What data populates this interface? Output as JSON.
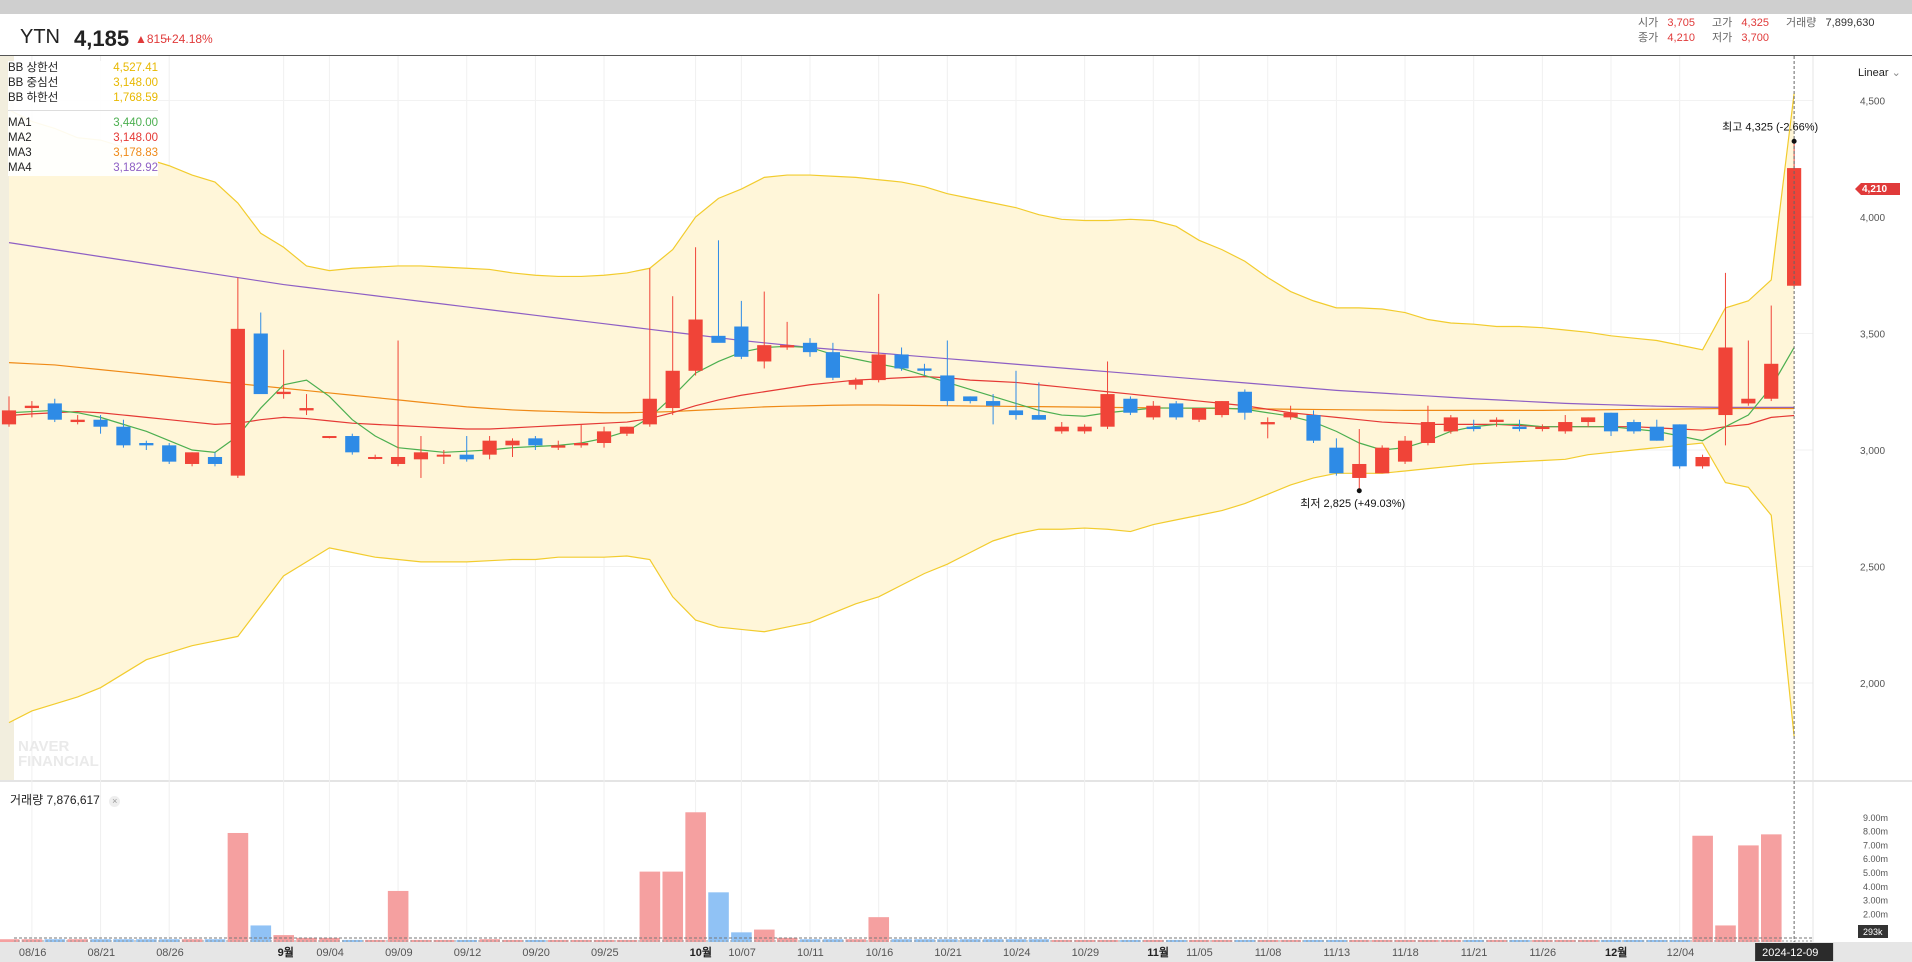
{
  "header": {
    "symbol": "YTN",
    "price": "4,185",
    "change": "▲815",
    "change_pct": "+24.18%",
    "open_label": "시가",
    "open": "3,705",
    "high_label": "고가",
    "high": "4,325",
    "volume_label": "거래량",
    "volume": "7,899,630",
    "close_label": "종가",
    "close": "4,210",
    "low_label": "저가",
    "low": "3,700"
  },
  "legend": [
    {
      "name": "BB 상한선",
      "value": "4,527.41",
      "color": "#e8b800"
    },
    {
      "name": "BB 중심선",
      "value": "3,148.00",
      "color": "#e8b800"
    },
    {
      "name": "BB 하한선",
      "value": "1,768.59",
      "color": "#e8b800"
    },
    {
      "name": "MA1",
      "value": "3,440.00",
      "color": "#4caf50"
    },
    {
      "name": "MA2",
      "value": "3,148.00",
      "color": "#e53935"
    },
    {
      "name": "MA3",
      "value": "3,178.83",
      "color": "#ef8a17"
    },
    {
      "name": "MA4",
      "value": "3,182.92",
      "color": "#8e5fc4"
    }
  ],
  "volume_legend": {
    "label": "거래량",
    "value": "7,876,617",
    "close": "×"
  },
  "scale_mode": "Linear",
  "watermark": "NAVER FINANCIAL",
  "colors": {
    "up": "#f04438",
    "down": "#2e8be6",
    "up_vol": "#f5a0a0",
    "down_vol": "#90c2f5",
    "band_fill": "#fff6d9",
    "band_line": "#f2cc2e",
    "price_tag": "#e03a3a"
  },
  "annotations": {
    "high": "최고 4,325 (-2.66%)",
    "low": "최저 2,825 (+49.03%)"
  },
  "price_tag": "4,210",
  "volume_tag": "293k",
  "crosshair_date": "2024-12-09",
  "chart_data": {
    "type": "candlestick",
    "y_axis": {
      "ticks": [
        2000,
        2500,
        3000,
        3500,
        4000,
        4500
      ],
      "tick_labels": [
        "2,000",
        "2,500",
        "3,000",
        "3,500",
        "4,000",
        "4,500"
      ],
      "range": [
        1700,
        4600
      ]
    },
    "volume_axis": {
      "ticks": [
        2000000,
        3000000,
        4000000,
        5000000,
        6000000,
        7000000,
        8000000,
        9000000
      ],
      "tick_labels": [
        "2.00m",
        "3.00m",
        "4.00m",
        "5.00m",
        "6.00m",
        "7.00m",
        "8.00m",
        "9.00m"
      ],
      "range": [
        0,
        10000000
      ]
    },
    "x_labels": [
      "08/16",
      "08/21",
      "08/26",
      "9월",
      "09/04",
      "09/09",
      "09/12",
      "09/20",
      "09/25",
      "10월",
      "10/07",
      "10/11",
      "10/16",
      "10/21",
      "10/24",
      "10/29",
      "11월",
      "11/05",
      "11/08",
      "11/13",
      "11/18",
      "11/21",
      "11/26",
      "12월",
      "12/04"
    ],
    "x_label_idx": [
      1,
      4,
      7,
      12,
      14,
      17,
      20,
      23,
      26,
      30,
      32,
      35,
      38,
      41,
      44,
      47,
      50,
      52,
      55,
      58,
      61,
      64,
      67,
      70,
      73
    ],
    "candles": [
      {
        "o": 3110,
        "h": 3230,
        "l": 3100,
        "c": 3170
      },
      {
        "o": 3180,
        "h": 3210,
        "l": 3140,
        "c": 3190
      },
      {
        "o": 3200,
        "h": 3220,
        "l": 3120,
        "c": 3130
      },
      {
        "o": 3120,
        "h": 3150,
        "l": 3110,
        "c": 3130
      },
      {
        "o": 3130,
        "h": 3150,
        "l": 3070,
        "c": 3100
      },
      {
        "o": 3100,
        "h": 3130,
        "l": 3010,
        "c": 3020
      },
      {
        "o": 3030,
        "h": 3040,
        "l": 3000,
        "c": 3020
      },
      {
        "o": 3020,
        "h": 3030,
        "l": 2940,
        "c": 2950
      },
      {
        "o": 2940,
        "h": 2990,
        "l": 2930,
        "c": 2990
      },
      {
        "o": 2970,
        "h": 2990,
        "l": 2930,
        "c": 2940
      },
      {
        "o": 2890,
        "h": 3740,
        "l": 2880,
        "c": 3520
      },
      {
        "o": 3500,
        "h": 3590,
        "l": 3250,
        "c": 3240
      },
      {
        "o": 3240,
        "h": 3430,
        "l": 3220,
        "c": 3250
      },
      {
        "o": 3170,
        "h": 3240,
        "l": 3150,
        "c": 3180
      },
      {
        "o": 3060,
        "h": 3060,
        "l": 3050,
        "c": 3060
      },
      {
        "o": 3060,
        "h": 3070,
        "l": 2980,
        "c": 2990
      },
      {
        "o": 2970,
        "h": 2980,
        "l": 2960,
        "c": 2970
      },
      {
        "o": 2940,
        "h": 3470,
        "l": 2930,
        "c": 2970
      },
      {
        "o": 2960,
        "h": 3060,
        "l": 2880,
        "c": 2990
      },
      {
        "o": 2980,
        "h": 3000,
        "l": 2940,
        "c": 2980
      },
      {
        "o": 2980,
        "h": 3060,
        "l": 2950,
        "c": 2960
      },
      {
        "o": 2980,
        "h": 3060,
        "l": 2960,
        "c": 3040
      },
      {
        "o": 3020,
        "h": 3050,
        "l": 2970,
        "c": 3040
      },
      {
        "o": 3050,
        "h": 3060,
        "l": 3000,
        "c": 3020
      },
      {
        "o": 3010,
        "h": 3040,
        "l": 3000,
        "c": 3020
      },
      {
        "o": 3020,
        "h": 3110,
        "l": 3010,
        "c": 3030
      },
      {
        "o": 3030,
        "h": 3100,
        "l": 3010,
        "c": 3080
      },
      {
        "o": 3070,
        "h": 3100,
        "l": 3060,
        "c": 3100
      },
      {
        "o": 3110,
        "h": 3780,
        "l": 3100,
        "c": 3220
      },
      {
        "o": 3180,
        "h": 3660,
        "l": 3150,
        "c": 3340
      },
      {
        "o": 3340,
        "h": 3870,
        "l": 3320,
        "c": 3560
      },
      {
        "o": 3490,
        "h": 3900,
        "l": 3470,
        "c": 3460
      },
      {
        "o": 3530,
        "h": 3640,
        "l": 3390,
        "c": 3400
      },
      {
        "o": 3380,
        "h": 3680,
        "l": 3350,
        "c": 3450
      },
      {
        "o": 3440,
        "h": 3550,
        "l": 3430,
        "c": 3450
      },
      {
        "o": 3460,
        "h": 3480,
        "l": 3400,
        "c": 3420
      },
      {
        "o": 3420,
        "h": 3460,
        "l": 3300,
        "c": 3310
      },
      {
        "o": 3280,
        "h": 3310,
        "l": 3260,
        "c": 3300
      },
      {
        "o": 3300,
        "h": 3670,
        "l": 3290,
        "c": 3410
      },
      {
        "o": 3410,
        "h": 3440,
        "l": 3340,
        "c": 3350
      },
      {
        "o": 3350,
        "h": 3370,
        "l": 3320,
        "c": 3340
      },
      {
        "o": 3320,
        "h": 3470,
        "l": 3190,
        "c": 3210
      },
      {
        "o": 3230,
        "h": 3230,
        "l": 3200,
        "c": 3210
      },
      {
        "o": 3210,
        "h": 3240,
        "l": 3110,
        "c": 3190
      },
      {
        "o": 3170,
        "h": 3340,
        "l": 3130,
        "c": 3150
      },
      {
        "o": 3150,
        "h": 3290,
        "l": 3130,
        "c": 3130
      },
      {
        "o": 3080,
        "h": 3120,
        "l": 3070,
        "c": 3100
      },
      {
        "o": 3080,
        "h": 3110,
        "l": 3070,
        "c": 3100
      },
      {
        "o": 3100,
        "h": 3380,
        "l": 3090,
        "c": 3240
      },
      {
        "o": 3220,
        "h": 3230,
        "l": 3150,
        "c": 3160
      },
      {
        "o": 3140,
        "h": 3210,
        "l": 3130,
        "c": 3190
      },
      {
        "o": 3200,
        "h": 3210,
        "l": 3130,
        "c": 3140
      },
      {
        "o": 3130,
        "h": 3180,
        "l": 3120,
        "c": 3180
      },
      {
        "o": 3150,
        "h": 3210,
        "l": 3140,
        "c": 3210
      },
      {
        "o": 3250,
        "h": 3260,
        "l": 3130,
        "c": 3160
      },
      {
        "o": 3110,
        "h": 3140,
        "l": 3050,
        "c": 3120
      },
      {
        "o": 3140,
        "h": 3190,
        "l": 3130,
        "c": 3160
      },
      {
        "o": 3150,
        "h": 3170,
        "l": 3030,
        "c": 3040
      },
      {
        "o": 3010,
        "h": 3050,
        "l": 2890,
        "c": 2900
      },
      {
        "o": 2880,
        "h": 3090,
        "l": 2825,
        "c": 2940
      },
      {
        "o": 2900,
        "h": 3020,
        "l": 2900,
        "c": 3010
      },
      {
        "o": 2950,
        "h": 3060,
        "l": 2940,
        "c": 3040
      },
      {
        "o": 3030,
        "h": 3190,
        "l": 3020,
        "c": 3120
      },
      {
        "o": 3080,
        "h": 3150,
        "l": 3070,
        "c": 3140
      },
      {
        "o": 3100,
        "h": 3130,
        "l": 3080,
        "c": 3090
      },
      {
        "o": 3120,
        "h": 3140,
        "l": 3100,
        "c": 3130
      },
      {
        "o": 3100,
        "h": 3130,
        "l": 3080,
        "c": 3090
      },
      {
        "o": 3090,
        "h": 3110,
        "l": 3080,
        "c": 3100
      },
      {
        "o": 3080,
        "h": 3150,
        "l": 3070,
        "c": 3120
      },
      {
        "o": 3120,
        "h": 3140,
        "l": 3100,
        "c": 3140
      },
      {
        "o": 3160,
        "h": 3160,
        "l": 3060,
        "c": 3080
      },
      {
        "o": 3120,
        "h": 3130,
        "l": 3070,
        "c": 3080
      },
      {
        "o": 3100,
        "h": 3130,
        "l": 3040,
        "c": 3040
      },
      {
        "o": 3110,
        "h": 3110,
        "l": 2920,
        "c": 2930
      },
      {
        "o": 2930,
        "h": 2980,
        "l": 2920,
        "c": 2970
      },
      {
        "o": 3150,
        "h": 3760,
        "l": 3020,
        "c": 3440
      },
      {
        "o": 3200,
        "h": 3470,
        "l": 3190,
        "c": 3220
      },
      {
        "o": 3220,
        "h": 3620,
        "l": 3210,
        "c": 3370
      },
      {
        "o": 3705,
        "h": 4325,
        "l": 3700,
        "c": 4210
      }
    ],
    "volume": [
      200000,
      200000,
      200000,
      200000,
      200000,
      200000,
      200000,
      200000,
      200000,
      200000,
      7900000,
      1200000,
      500000,
      300000,
      300000,
      150000,
      150000,
      3700000,
      150000,
      150000,
      150000,
      200000,
      150000,
      150000,
      150000,
      150000,
      150000,
      150000,
      5100000,
      5100000,
      9400000,
      3600000,
      700000,
      900000,
      300000,
      200000,
      200000,
      200000,
      1800000,
      200000,
      200000,
      200000,
      200000,
      200000,
      200000,
      200000,
      150000,
      150000,
      150000,
      150000,
      150000,
      150000,
      150000,
      150000,
      150000,
      150000,
      150000,
      150000,
      150000,
      150000,
      150000,
      150000,
      150000,
      150000,
      150000,
      150000,
      150000,
      150000,
      150000,
      150000,
      150000,
      150000,
      150000,
      150000,
      7700000,
      1200000,
      7000000,
      7800000
    ],
    "bb_upper": [
      4460,
      4410,
      4380,
      4340,
      4330,
      4300,
      4250,
      4220,
      4180,
      4150,
      4060,
      3930,
      3870,
      3790,
      3770,
      3780,
      3785,
      3790,
      3790,
      3785,
      3780,
      3775,
      3760,
      3750,
      3745,
      3745,
      3750,
      3760,
      3780,
      3860,
      4000,
      4080,
      4120,
      4170,
      4180,
      4180,
      4175,
      4170,
      4160,
      4150,
      4130,
      4100,
      4080,
      4060,
      4040,
      4010,
      3990,
      3985,
      3985,
      3990,
      3985,
      3960,
      3900,
      3860,
      3810,
      3740,
      3680,
      3640,
      3610,
      3610,
      3605,
      3590,
      3560,
      3545,
      3540,
      3530,
      3530,
      3525,
      3515,
      3505,
      3490,
      3480,
      3470,
      3450,
      3430,
      3610,
      3640,
      3730,
      4530
    ],
    "bb_mid": [
      3148,
      3150,
      3152,
      3154,
      3155,
      3150,
      3145,
      3140,
      3132,
      3125,
      3120,
      3115,
      3110,
      3108,
      3110,
      3112,
      3110,
      3108,
      3105,
      3100,
      3098,
      3095,
      3092,
      3090,
      3090,
      3090,
      3092,
      3095,
      3100,
      3120,
      3140,
      3160,
      3180,
      3200,
      3215,
      3230,
      3240,
      3245,
      3250,
      3252,
      3250,
      3248,
      3245,
      3240,
      3235,
      3230,
      3225,
      3220,
      3210,
      3200,
      3195,
      3190,
      3185,
      3180,
      3175,
      3170,
      3165,
      3160,
      3155,
      3150,
      3145,
      3145,
      3145,
      3145,
      3145,
      3145,
      3145,
      3145,
      3148,
      3148,
      3148,
      3148,
      3148,
      3148,
      3148,
      3148,
      3148,
      3148,
      3148
    ],
    "bb_lower": [
      1830,
      1880,
      1910,
      1940,
      1980,
      2040,
      2100,
      2130,
      2160,
      2180,
      2200,
      2330,
      2460,
      2520,
      2580,
      2560,
      2540,
      2530,
      2520,
      2520,
      2520,
      2525,
      2530,
      2530,
      2540,
      2540,
      2540,
      2545,
      2530,
      2370,
      2270,
      2240,
      2230,
      2220,
      2240,
      2260,
      2300,
      2340,
      2370,
      2420,
      2470,
      2510,
      2560,
      2610,
      2640,
      2660,
      2660,
      2665,
      2660,
      2650,
      2680,
      2700,
      2720,
      2740,
      2770,
      2810,
      2850,
      2880,
      2900,
      2900,
      2900,
      2910,
      2920,
      2930,
      2940,
      2945,
      2950,
      2955,
      2960,
      2980,
      2990,
      3000,
      3010,
      3020,
      3030,
      2860,
      2840,
      2720,
      1770
    ],
    "ma1": [
      3160,
      3165,
      3170,
      3160,
      3140,
      3110,
      3080,
      3040,
      3000,
      2990,
      3060,
      3180,
      3280,
      3300,
      3230,
      3130,
      3060,
      3010,
      3000,
      2990,
      2995,
      3000,
      3010,
      3015,
      3020,
      3030,
      3050,
      3080,
      3140,
      3230,
      3330,
      3380,
      3420,
      3440,
      3445,
      3440,
      3410,
      3390,
      3370,
      3350,
      3320,
      3290,
      3260,
      3230,
      3200,
      3170,
      3150,
      3145,
      3160,
      3170,
      3180,
      3180,
      3180,
      3180,
      3175,
      3160,
      3145,
      3120,
      3080,
      3030,
      3000,
      3010,
      3040,
      3080,
      3100,
      3110,
      3110,
      3100,
      3100,
      3100,
      3100,
      3090,
      3080,
      3060,
      3040,
      3100,
      3150,
      3270,
      3440
    ],
    "ma2": [
      3148,
      3155,
      3160,
      3165,
      3160,
      3150,
      3140,
      3130,
      3120,
      3110,
      3115,
      3130,
      3140,
      3135,
      3125,
      3115,
      3110,
      3105,
      3100,
      3095,
      3090,
      3090,
      3095,
      3100,
      3105,
      3110,
      3115,
      3120,
      3135,
      3160,
      3190,
      3215,
      3235,
      3250,
      3265,
      3280,
      3290,
      3300,
      3305,
      3310,
      3315,
      3310,
      3300,
      3295,
      3290,
      3280,
      3270,
      3260,
      3250,
      3240,
      3230,
      3220,
      3210,
      3200,
      3190,
      3175,
      3160,
      3150,
      3140,
      3130,
      3120,
      3115,
      3110,
      3110,
      3110,
      3110,
      3105,
      3100,
      3100,
      3100,
      3100,
      3100,
      3095,
      3090,
      3085,
      3100,
      3110,
      3140,
      3148
    ],
    "ma3": [
      3375,
      3370,
      3365,
      3355,
      3345,
      3335,
      3325,
      3315,
      3305,
      3295,
      3285,
      3275,
      3265,
      3255,
      3245,
      3235,
      3225,
      3215,
      3205,
      3195,
      3185,
      3178,
      3172,
      3168,
      3165,
      3162,
      3160,
      3160,
      3162,
      3165,
      3170,
      3175,
      3180,
      3185,
      3188,
      3190,
      3192,
      3193,
      3193,
      3192,
      3191,
      3190,
      3189,
      3188,
      3187,
      3186,
      3185,
      3184,
      3183,
      3182,
      3181,
      3180,
      3179,
      3178,
      3177,
      3176,
      3175,
      3174,
      3173,
      3172,
      3171,
      3170,
      3170,
      3170,
      3170,
      3170,
      3170,
      3170,
      3171,
      3172,
      3173,
      3174,
      3175,
      3176,
      3177,
      3178,
      3178,
      3178,
      3178
    ],
    "ma4": [
      3890,
      3875,
      3860,
      3845,
      3830,
      3815,
      3800,
      3785,
      3770,
      3755,
      3740,
      3725,
      3710,
      3698,
      3686,
      3674,
      3662,
      3650,
      3638,
      3626,
      3614,
      3602,
      3590,
      3578,
      3566,
      3554,
      3542,
      3530,
      3518,
      3506,
      3494,
      3482,
      3470,
      3460,
      3450,
      3440,
      3432,
      3424,
      3416,
      3408,
      3400,
      3392,
      3384,
      3376,
      3368,
      3360,
      3352,
      3344,
      3336,
      3328,
      3320,
      3312,
      3304,
      3296,
      3288,
      3280,
      3272,
      3264,
      3256,
      3250,
      3244,
      3238,
      3232,
      3226,
      3220,
      3215,
      3210,
      3205,
      3200,
      3197,
      3194,
      3191,
      3188,
      3186,
      3184,
      3183,
      3183,
      3183,
      3183
    ]
  }
}
